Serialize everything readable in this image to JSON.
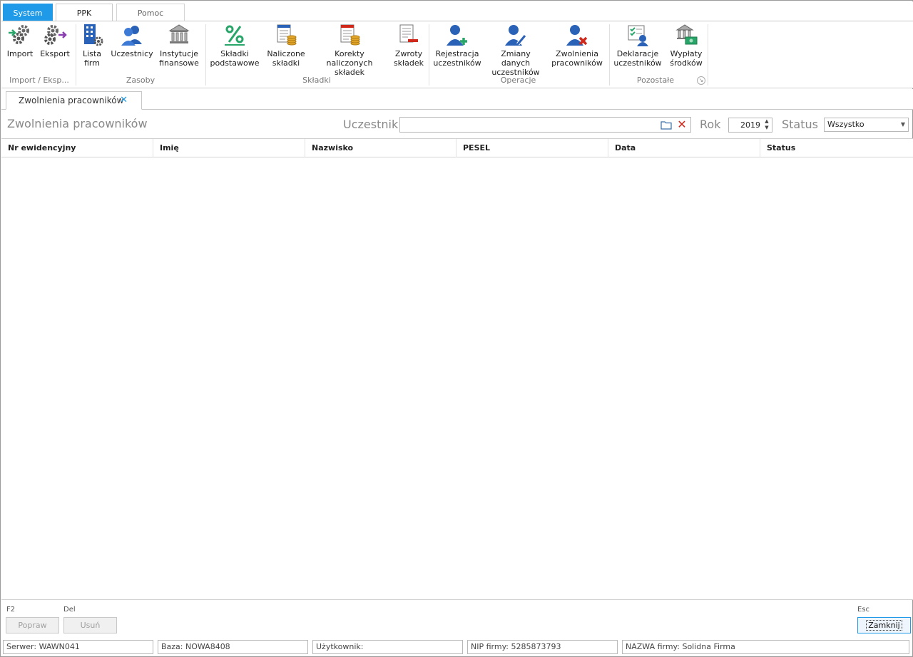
{
  "ribbon_tabs": [
    "System",
    "PPK",
    "Pomoc"
  ],
  "ribbon": {
    "buttons": [
      {
        "l1": "Import",
        "l2": "",
        "icon": "gears-import-icon"
      },
      {
        "l1": "Eksport",
        "l2": "",
        "icon": "gears-export-icon"
      },
      {
        "l1": "Lista",
        "l2": "firm",
        "icon": "building-list-icon"
      },
      {
        "l1": "Uczestnicy",
        "l2": "",
        "icon": "users-icon"
      },
      {
        "l1": "Instytucje",
        "l2": "finansowe",
        "icon": "bank-icon"
      },
      {
        "l1": "Składki",
        "l2": "podstawowe",
        "icon": "percent-icon"
      },
      {
        "l1": "Naliczone",
        "l2": "składki",
        "icon": "calculated-fees-icon"
      },
      {
        "l1": "Korekty naliczonych",
        "l2": "składek",
        "icon": "fee-corrections-icon"
      },
      {
        "l1": "Zwroty",
        "l2": "składek",
        "icon": "fee-refunds-icon"
      },
      {
        "l1": "Rejestracja",
        "l2": "uczestników",
        "icon": "user-add-icon"
      },
      {
        "l1": "Zmiany danych",
        "l2": "uczestników",
        "icon": "user-edit-icon"
      },
      {
        "l1": "Zwolnienia",
        "l2": "pracowników",
        "icon": "user-remove-icon"
      },
      {
        "l1": "Deklaracje",
        "l2": "uczestników",
        "icon": "declarations-icon"
      },
      {
        "l1": "Wypłaty",
        "l2": "środków",
        "icon": "payouts-icon"
      }
    ],
    "groups": [
      "Import / Eksp...",
      "Zasoby",
      "Składki",
      "Operacje",
      "Pozostałe"
    ]
  },
  "doc_tab": {
    "label": "Zwolnienia pracowników",
    "close": "✕"
  },
  "filter": {
    "title": "Zwolnienia pracowników",
    "participant_label": "Uczestnik",
    "participant_value": "",
    "year_label": "Rok",
    "year_value": "2019",
    "status_label": "Status",
    "status_value": "Wszystko"
  },
  "grid": {
    "columns": [
      "Nr ewidencyjny",
      "Imię",
      "Nazwisko",
      "PESEL",
      "Data",
      "Status"
    ],
    "rows": []
  },
  "actions": {
    "f2": "F2",
    "edit": "Popraw",
    "del": "Del",
    "delete": "Usuń",
    "esc": "Esc",
    "close": "Zamknij"
  },
  "statusbar": {
    "server": "Serwer: WAWN041",
    "db": "Baza: NOWA8408",
    "user": "Użytkownik:",
    "nip": "NIP firmy: 5285873793",
    "company": "NAZWA firmy: Solidna Firma"
  },
  "colors": {
    "accent": "#1e9ae8",
    "danger": "#d0281a",
    "user_blue": "#2a62b8",
    "green": "#28a66a"
  }
}
